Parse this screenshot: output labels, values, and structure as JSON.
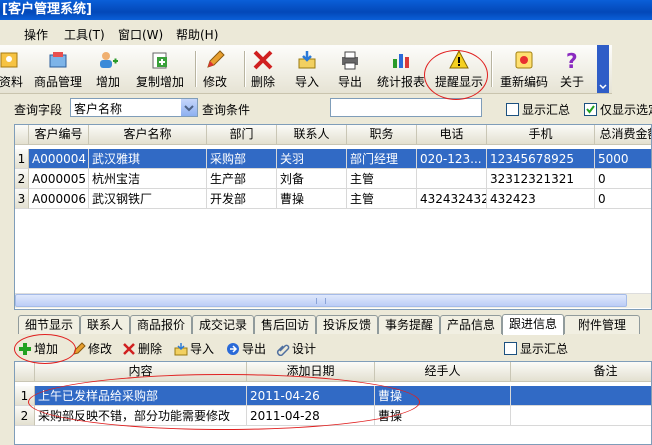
{
  "window": {
    "title": "[客户管理系统]"
  },
  "menu": [
    "操作",
    "工具(T)",
    "窗口(W)",
    "帮助(H)"
  ],
  "toolbar": [
    {
      "label": "资料",
      "icon": "person-card-icon"
    },
    {
      "label": "商品管理",
      "icon": "goods-icon"
    },
    {
      "label": "增加",
      "icon": "add-person-icon"
    },
    {
      "label": "复制增加",
      "icon": "copy-add-icon"
    },
    {
      "label": "修改",
      "icon": "pencil-icon"
    },
    {
      "label": "删除",
      "icon": "delete-x-icon"
    },
    {
      "label": "导入",
      "icon": "import-icon"
    },
    {
      "label": "导出",
      "icon": "export-printer-icon"
    },
    {
      "label": "统计报表",
      "icon": "bar-chart-icon"
    },
    {
      "label": "提醒显示",
      "icon": "warning-icon"
    },
    {
      "label": "重新编码",
      "icon": "recode-icon"
    },
    {
      "label": "关于",
      "icon": "question-icon"
    }
  ],
  "query": {
    "field_label": "查询字段",
    "field_value": "客户名称",
    "cond_label": "查询条件",
    "cond_value": "",
    "show_summary": "显示汇总",
    "only_show": "仅显示选定"
  },
  "main_table": {
    "columns": [
      "客户编号",
      "客户名称",
      "部门",
      "联系人",
      "职务",
      "电话",
      "手机",
      "总消费金额"
    ],
    "rows": [
      [
        "A000004",
        "武汉雅琪",
        "采购部",
        "关羽",
        "部门经理",
        "020-123...",
        "12345678925",
        "5000"
      ],
      [
        "A000005",
        "杭州宝洁",
        "生产部",
        "刘备",
        "主管",
        "",
        "32312321321",
        "0"
      ],
      [
        "A000006",
        "武汉钢铁厂",
        "开发部",
        "曹操",
        "主管",
        "432432432",
        "432423",
        "0"
      ]
    ]
  },
  "tabs": [
    "细节显示",
    "联系人",
    "商品报价",
    "成交记录",
    "售后回访",
    "投诉反馈",
    "事务提醒",
    "产品信息",
    "跟进信息",
    "附件管理"
  ],
  "active_tab": "跟进信息",
  "subtoolbar": {
    "add": "增加",
    "edit": "修改",
    "delete": "删除",
    "import": "导入",
    "export": "导出",
    "design": "设计",
    "show_summary": "显示汇总"
  },
  "sub_table": {
    "columns": [
      "内容",
      "添加日期",
      "经手人",
      "备注"
    ],
    "rows": [
      [
        "上午已发样品给采购部",
        "2011-04-26",
        "曹操",
        ""
      ],
      [
        "采购部反映不错，部分功能需要修改",
        "2011-04-28",
        "曹操",
        ""
      ]
    ]
  },
  "colors": {
    "title": "#0a5fd8",
    "selection": "#316ac5",
    "highlight": "#e02020"
  }
}
